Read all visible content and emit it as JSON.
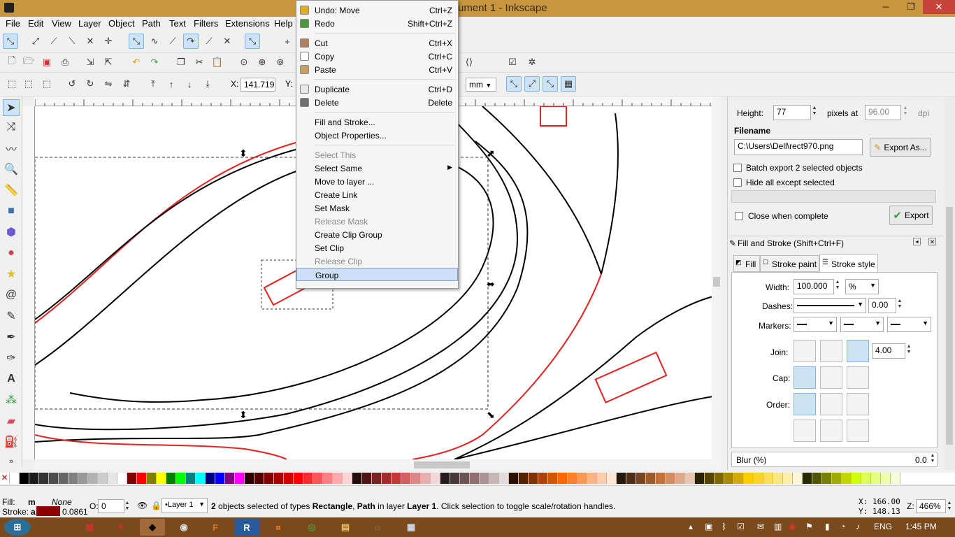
{
  "window": {
    "title": "ument 1 - Inkscape",
    "minimize": "─",
    "restore": "❐",
    "close": "✕"
  },
  "menubar": [
    "File",
    "Edit",
    "View",
    "Layer",
    "Object",
    "Path",
    "Text",
    "Filters",
    "Extensions",
    "Help"
  ],
  "toolbar": {
    "x_label": "X:",
    "x_value": "141.719",
    "y_label": "Y:",
    "unit": "mm"
  },
  "context_menu": [
    {
      "label": "Undo: Move",
      "shortcut": "Ctrl+Z",
      "icon": "undo-icon",
      "color": "#e0b020"
    },
    {
      "label": "Redo",
      "shortcut": "Shift+Ctrl+Z",
      "icon": "redo-icon",
      "color": "#4a9a3a"
    },
    {
      "sep": true
    },
    {
      "label": "Cut",
      "shortcut": "Ctrl+X",
      "icon": "scissors-icon",
      "color": "#b08060"
    },
    {
      "label": "Copy",
      "shortcut": "Ctrl+C",
      "icon": "copy-icon",
      "color": "#ffffff"
    },
    {
      "label": "Paste",
      "shortcut": "Ctrl+V",
      "icon": "paste-icon",
      "color": "#c8a060"
    },
    {
      "sep": true
    },
    {
      "label": "Duplicate",
      "shortcut": "Ctrl+D",
      "icon": "duplicate-icon",
      "color": "#e8e8e8"
    },
    {
      "label": "Delete",
      "shortcut": "Delete",
      "icon": "trash-icon",
      "color": "#707070"
    },
    {
      "sep": true
    },
    {
      "label": "Fill and Stroke..."
    },
    {
      "label": "Object Properties..."
    },
    {
      "sep": true
    },
    {
      "label": "Select This",
      "disabled": true
    },
    {
      "label": "Select Same",
      "submenu": true
    },
    {
      "label": "Move to layer ..."
    },
    {
      "label": "Create Link"
    },
    {
      "label": "Set Mask"
    },
    {
      "label": "Release Mask",
      "disabled": true
    },
    {
      "label": "Create Clip Group"
    },
    {
      "label": "Set Clip"
    },
    {
      "label": "Release Clip",
      "disabled": true
    },
    {
      "label": "Group",
      "highlighted": true
    }
  ],
  "export": {
    "height_label": "Height:",
    "height_value": "77",
    "pixels_at": "pixels at",
    "dpi_value": "96.00",
    "dpi": "dpi",
    "filename_label": "Filename",
    "filename": "C:\\Users\\Dell\\rect970.png",
    "export_as": "Export As...",
    "batch": "Batch export 2 selected objects",
    "hide": "Hide all except selected",
    "close_when": "Close when complete",
    "export_btn": "Export"
  },
  "fill_stroke": {
    "title": "Fill and Stroke (Shift+Ctrl+F)",
    "tabs": [
      "Fill",
      "Stroke paint",
      "Stroke style"
    ],
    "width_label": "Width:",
    "width_value": "100.000",
    "width_unit": "%",
    "dashes_label": "Dashes:",
    "dashes_value": "0.00",
    "markers_label": "Markers:",
    "join_label": "Join:",
    "join_value": "4.00",
    "cap_label": "Cap:",
    "order_label": "Order:",
    "blur_label": "Blur (%)",
    "blur_value": "0.0"
  },
  "statusbar": {
    "fill_label": "Fill:",
    "fill_value": "m",
    "fill_none": "None",
    "stroke_label": "Stroke:",
    "stroke_value": "a",
    "stroke_width": "0.0861",
    "opacity_label": "O:",
    "opacity_value": "0",
    "layer": "•Layer 1",
    "message_bold1": "2",
    "message_1": " objects selected of types ",
    "message_bold2": "Rectangle",
    "message_2": ", ",
    "message_bold3": "Path",
    "message_3": " in layer ",
    "message_bold4": "Layer 1",
    "message_4": ". Click selection to toggle scale/rotation handles.",
    "x_label": "X:",
    "x": "166.00",
    "y_label": "Y:",
    "y": "148.13",
    "z_label": "Z:",
    "zoom": "466%"
  },
  "taskbar": {
    "lang": "ENG",
    "time": "1:45 PM"
  },
  "colors": {
    "stroke_red": "#e8201e",
    "selection_blue": "#cde4f7",
    "stroke_swatch": "#8b0000"
  }
}
